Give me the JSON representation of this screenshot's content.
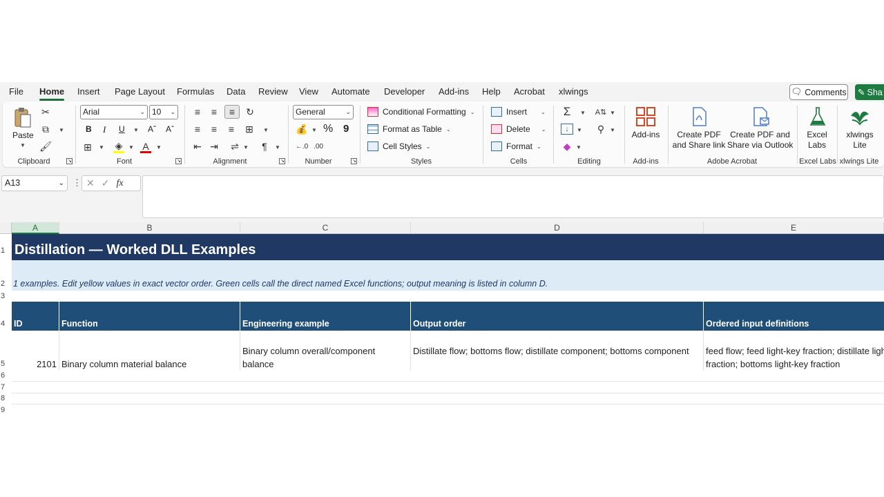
{
  "ribbon_tabs": [
    "File",
    "Home",
    "Insert",
    "Page Layout",
    "Formulas",
    "Data",
    "Review",
    "View",
    "Automate",
    "Developer",
    "Add-ins",
    "Help",
    "Acrobat",
    "xlwings"
  ],
  "active_tab": "Home",
  "comments_label": "Comments",
  "share_label": "Sha",
  "clipboard": {
    "paste": "Paste",
    "group": "Clipboard"
  },
  "font": {
    "name": "Arial",
    "size": "10",
    "group": "Font",
    "bold": "B",
    "italic": "I",
    "underline": "U"
  },
  "alignment": {
    "group": "Alignment"
  },
  "number": {
    "format": "General",
    "group": "Number",
    "percent": "%",
    "comma": "9"
  },
  "styles": {
    "conditional": "Conditional Formatting",
    "format_table": "Format as Table",
    "cell_styles": "Cell Styles",
    "group": "Styles"
  },
  "cells": {
    "insert": "Insert",
    "delete": "Delete",
    "format": "Format",
    "group": "Cells"
  },
  "editing": {
    "group": "Editing"
  },
  "addins": {
    "label": "Add-ins",
    "group": "Add-ins"
  },
  "acrobat": {
    "create_pdf_link_1": "Create PDF",
    "create_pdf_link_2": "and Share link",
    "create_pdf_outlook_1": "Create PDF and",
    "create_pdf_outlook_2": "Share via Outlook",
    "group": "Adobe Acrobat"
  },
  "excel_labs": {
    "label_1": "Excel",
    "label_2": "Labs",
    "group": "Excel Labs"
  },
  "xlwings_lite": {
    "label_1": "xlwings",
    "label_2": "Lite",
    "group": "xlwings Lite"
  },
  "name_box": "A13",
  "columns": [
    "A",
    "B",
    "C",
    "D",
    "E"
  ],
  "selected_column": "A",
  "rows": [
    "1",
    "2",
    "3",
    "4",
    "5",
    "6",
    "7",
    "8",
    "9"
  ],
  "sheet": {
    "title": "Distillation — Worked DLL Examples",
    "subtitle": "1 examples. Edit yellow values in exact vector order. Green cells call the direct named Excel functions; output meaning is listed in column D.",
    "headers": [
      "ID",
      "Function",
      "Engineering example",
      "Output order",
      "Ordered input definitions"
    ],
    "data_row": {
      "id": "2101",
      "function": "Binary column material balance",
      "example": "Binary column overall/component balance",
      "output": "Distillate flow; bottoms flow; distillate component; bottoms component",
      "inputs": "feed flow; feed light-key fraction; distillate light-key fraction; bottoms light-key fraction"
    }
  },
  "colors": {
    "title_bg": "#1f3864",
    "subtitle_bg": "#ddebf7",
    "header_bg": "#1f4e79",
    "accent": "#1e7b3f"
  }
}
